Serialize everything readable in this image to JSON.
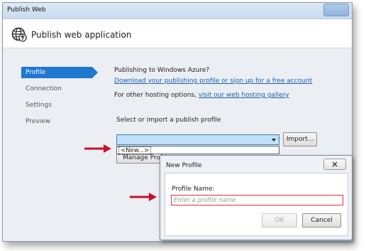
{
  "window": {
    "title": "Publish Web"
  },
  "header": {
    "title": "Publish web application",
    "icon": "globe-publish-icon"
  },
  "nav": {
    "items": [
      {
        "label": "Profile",
        "active": true
      },
      {
        "label": "Connection",
        "active": false
      },
      {
        "label": "Settings",
        "active": false
      },
      {
        "label": "Preview",
        "active": false
      }
    ]
  },
  "main": {
    "azure_heading": "Publishing to Windows Azure?",
    "azure_link": "Download your publishing profile or sign up for a free account",
    "hosting_prefix": "For other hosting options,",
    "hosting_link": "visit our web hosting gallery",
    "select_label": "Select or import a publish profile",
    "import_label": "Import...",
    "dropdown_option": "<New...>",
    "manage_label": "Manage Prof"
  },
  "dialog": {
    "title": "New Profile",
    "field_label": "Profile Name:",
    "placeholder": "Enter a profile name",
    "value": "",
    "ok_label": "OK",
    "cancel_label": "Cancel"
  },
  "colors": {
    "accent": "#1f77d0",
    "link": "#1a5fb4",
    "callout_arrow": "#c8102e",
    "error_border": "#e0313a"
  }
}
